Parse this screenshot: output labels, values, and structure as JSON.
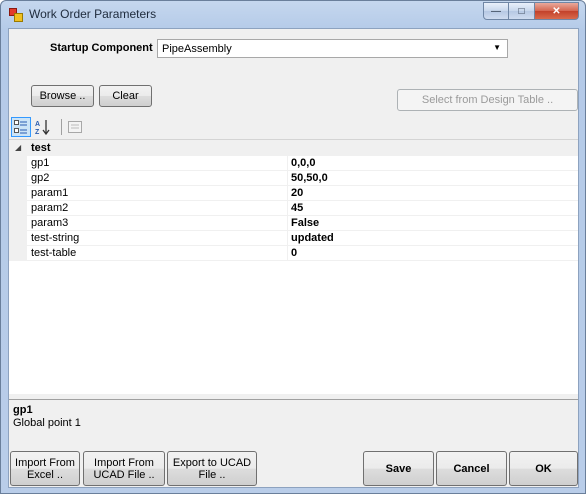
{
  "window": {
    "title": "Work Order Parameters",
    "caption_buttons": {
      "minimize": "—",
      "maximize": "□",
      "close": "✕"
    }
  },
  "startup": {
    "label": "Startup Component",
    "selected": "PipeAssembly"
  },
  "buttons": {
    "browse": "Browse ..",
    "clear": "Clear",
    "select_design_table": "Select from Design Table .."
  },
  "toolbar": {
    "categorized_icon": "categorized-icon",
    "alphabetical_icon": "alphabetical-icon",
    "property_pages_icon": "property-pages-icon"
  },
  "grid": {
    "category": "test",
    "rows": [
      {
        "name": "gp1",
        "value": "0,0,0"
      },
      {
        "name": "gp2",
        "value": "50,50,0"
      },
      {
        "name": "param1",
        "value": "20"
      },
      {
        "name": "param2",
        "value": "45"
      },
      {
        "name": "param3",
        "value": "False"
      },
      {
        "name": "test-string",
        "value": "updated"
      },
      {
        "name": "test-table",
        "value": "0"
      }
    ]
  },
  "help": {
    "title": "gp1",
    "description": "Global point 1"
  },
  "footer": {
    "import_excel_1": "Import From",
    "import_excel_2": "Excel ..",
    "import_ucad_1": "Import From",
    "import_ucad_2": "UCAD File ..",
    "export_ucad_1": "Export to UCAD",
    "export_ucad_2": "File ..",
    "save": "Save",
    "cancel": "Cancel",
    "ok": "OK"
  }
}
